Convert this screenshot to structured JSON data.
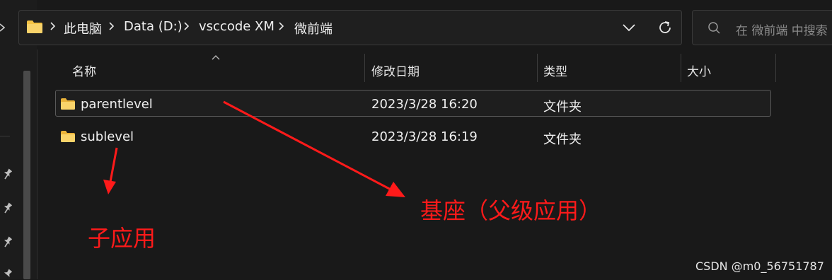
{
  "breadcrumb": {
    "items": [
      "此电脑",
      "Data (D:)",
      "vsccode XM",
      "微前端"
    ]
  },
  "search": {
    "placeholder": "在 微前端 中搜索"
  },
  "columns": [
    {
      "label": "名称"
    },
    {
      "label": "修改日期"
    },
    {
      "label": "类型"
    },
    {
      "label": "大小"
    }
  ],
  "rows": [
    {
      "name": "parentlevel",
      "modified": "2023/3/28 16:20",
      "type": "文件夹",
      "size": ""
    },
    {
      "name": "sublevel",
      "modified": "2023/3/28 16:19",
      "type": "文件夹",
      "size": ""
    }
  ],
  "annotations": {
    "base_label": "基座（父级应用）",
    "child_label": "子应用",
    "color": "#ff1a1a"
  },
  "watermark": "CSDN @m0_56751787",
  "colors": {
    "background": "#191919",
    "folder": "#f5c344",
    "text": "#efefef"
  }
}
